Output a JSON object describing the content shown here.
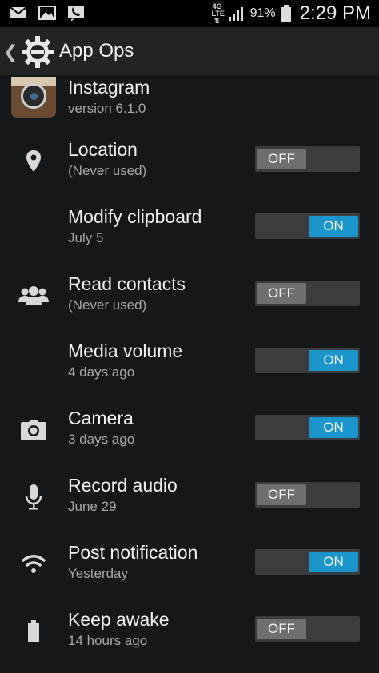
{
  "status_bar": {
    "network_type": "4G LTE",
    "battery_percent": "91%",
    "time": "2:29 PM",
    "notification_icons": [
      "email-icon",
      "image-icon",
      "missed-call-icon"
    ]
  },
  "action_bar": {
    "title": "App Ops",
    "back_glyph": "❮"
  },
  "app": {
    "name": "Instagram",
    "version": "version 6.1.0"
  },
  "permissions": [
    {
      "title": "Location",
      "subtitle": "(Never used)",
      "state": "OFF",
      "icon": "location-icon"
    },
    {
      "title": "Modify clipboard",
      "subtitle": "July 5",
      "state": "ON",
      "icon": ""
    },
    {
      "title": "Read contacts",
      "subtitle": "(Never used)",
      "state": "OFF",
      "icon": "contacts-icon"
    },
    {
      "title": "Media volume",
      "subtitle": "4 days ago",
      "state": "ON",
      "icon": ""
    },
    {
      "title": "Camera",
      "subtitle": "3 days ago",
      "state": "ON",
      "icon": "camera-icon"
    },
    {
      "title": "Record audio",
      "subtitle": "June 29",
      "state": "OFF",
      "icon": "microphone-icon"
    },
    {
      "title": "Post notification",
      "subtitle": "Yesterday",
      "state": "ON",
      "icon": "wifi-icon"
    },
    {
      "title": "Keep awake",
      "subtitle": "14 hours ago",
      "state": "OFF",
      "icon": "battery-icon"
    }
  ],
  "colors": {
    "toggle_on": "#1a96cc",
    "toggle_off": "#6d6f72",
    "background": "#15181b"
  }
}
